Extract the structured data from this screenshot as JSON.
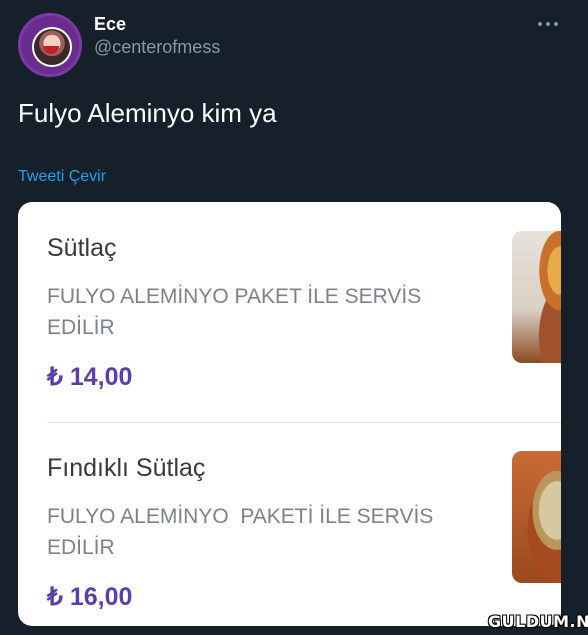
{
  "tweet": {
    "author": {
      "display_name": "Ece",
      "handle": "@centerofmess"
    },
    "text": "Fulyo Aleminyo kim ya",
    "translate_label": "Tweeti Çevir",
    "more_icon": "more-horizontal-icon"
  },
  "card": {
    "items": [
      {
        "title": "Sütlaç",
        "description": "FULYO ALEMİNYO PAKET İLE SERVİS\nEDİLİR",
        "price": "₺ 14,00"
      },
      {
        "title": "Fındıklı Sütlaç",
        "description": "FULYO ALEMİNYO  PAKETİ İLE SERVİS\nEDİLİR",
        "price": "₺ 16,00"
      }
    ]
  },
  "watermark": "GULDUM.NET",
  "colors": {
    "background": "#15202b",
    "handle": "#8899a6",
    "link": "#1da1f2",
    "price": "#5a3fa8"
  }
}
